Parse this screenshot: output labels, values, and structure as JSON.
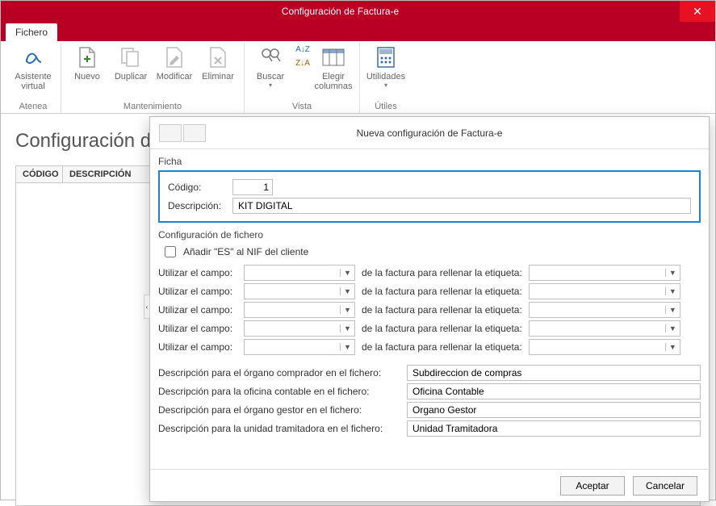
{
  "window": {
    "title": "Configuración de Factura-e",
    "close": "✕"
  },
  "tabs": {
    "file": "Fichero"
  },
  "ribbon": {
    "assistant": {
      "label": "Asistente\nvirtual",
      "group": "Atenea"
    },
    "new": "Nuevo",
    "duplicate": "Duplicar",
    "modify": "Modificar",
    "delete": "Eliminar",
    "maintenance_group": "Mantenimiento",
    "search": "Buscar",
    "sort_az": "A↓Z",
    "sort_za": "Z↓A",
    "choose_cols": "Elegir\ncolumnas",
    "view_group": "Vista",
    "utilities": "Utilidades",
    "utils_group": "Útiles"
  },
  "behind": {
    "title": "Configuración de",
    "col_code": "CÓDIGO",
    "col_desc": "DESCRIPCIÓN"
  },
  "dialog": {
    "title": "Nueva configuración de Factura-e",
    "ficha": "Ficha",
    "code_label": "Código:",
    "code_value": "1",
    "desc_label": "Descripción:",
    "desc_value": "KIT DIGITAL",
    "file_config": "Configuración de fichero",
    "add_es": "Añadir \"ES\" al NIF del cliente",
    "use_field": "Utilizar el campo:",
    "fill_tag": "de la factura para rellenar la etiqueta:",
    "map_rows": [
      {
        "src": "",
        "tag": ""
      },
      {
        "src": "",
        "tag": ""
      },
      {
        "src": "",
        "tag": ""
      },
      {
        "src": "",
        "tag": ""
      },
      {
        "src": "",
        "tag": ""
      }
    ],
    "desc_rows": [
      {
        "label": "Descripción para el órgano comprador en el fichero:",
        "value": "Subdireccion de compras"
      },
      {
        "label": "Descripción para la oficina contable en el fichero:",
        "value": "Oficina Contable"
      },
      {
        "label": "Descripción para el órgano gestor en el fichero:",
        "value": "Organo Gestor"
      },
      {
        "label": "Descripción para la unidad tramitadora en el fichero:",
        "value": "Unidad Tramitadora"
      }
    ],
    "accept": "Aceptar",
    "cancel": "Cancelar",
    "collapse": "‹"
  }
}
